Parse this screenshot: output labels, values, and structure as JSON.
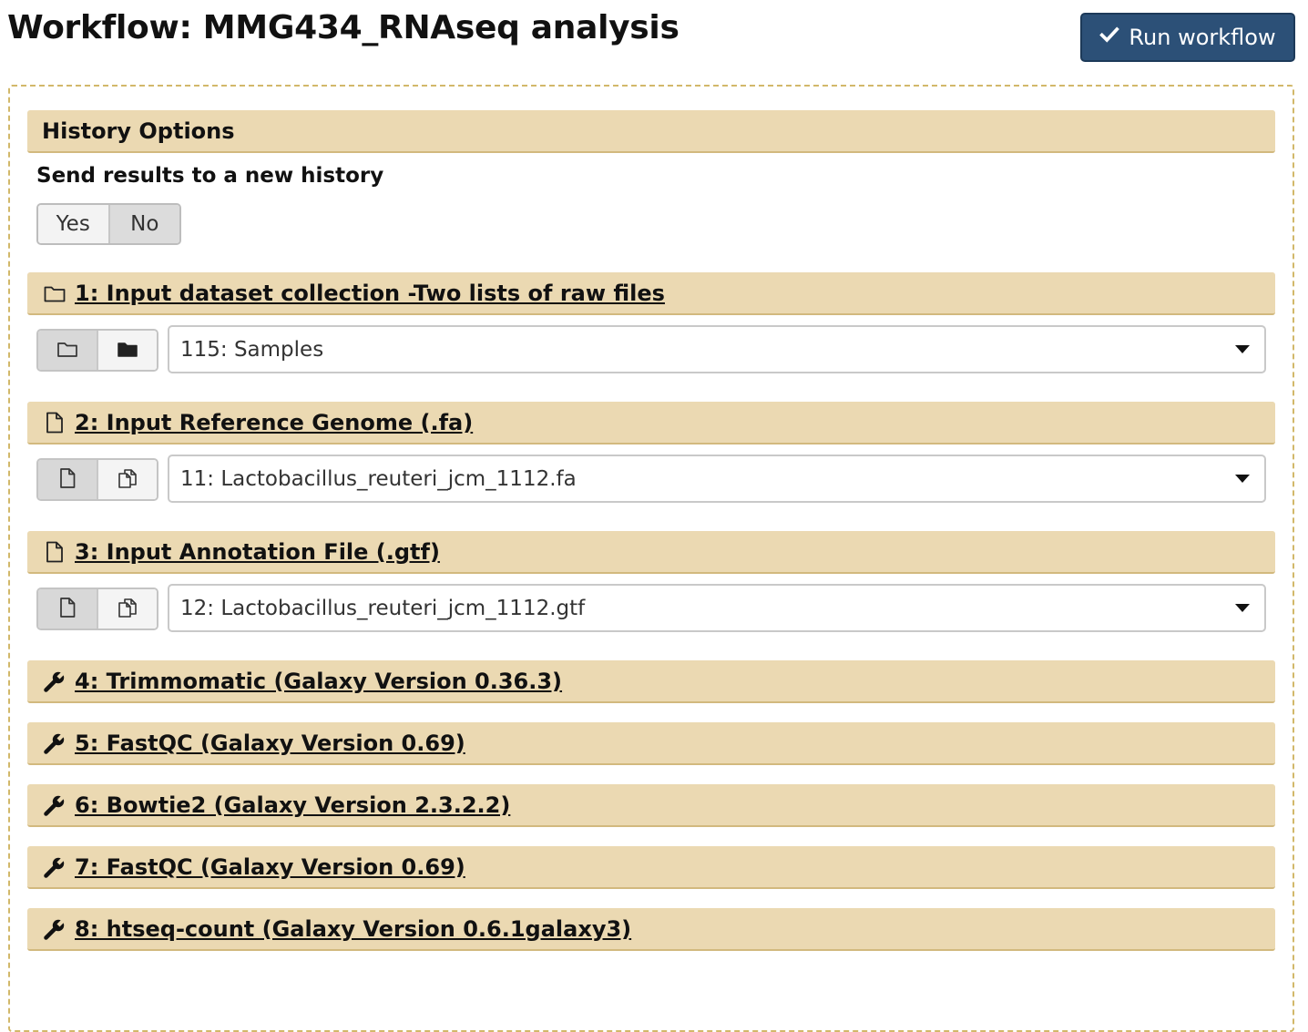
{
  "header": {
    "title": "Workflow: MMG434_RNAseq analysis",
    "run_button_label": "Run workflow"
  },
  "history_options": {
    "heading": "History Options",
    "send_label": "Send results to a new history",
    "toggle": {
      "yes_label": "Yes",
      "no_label": "No",
      "selected": "No"
    }
  },
  "inputs": [
    {
      "title": "1: Input dataset collection -Two lists of raw files",
      "icon": "folder-icon",
      "selected_value": "115: Samples"
    },
    {
      "title": "2: Input Reference Genome (.fa)",
      "icon": "file-icon",
      "selected_value": "11: Lactobacillus_reuteri_jcm_1112.fa"
    },
    {
      "title": "3: Input Annotation File (.gtf)",
      "icon": "file-icon",
      "selected_value": "12: Lactobacillus_reuteri_jcm_1112.gtf"
    }
  ],
  "steps": [
    {
      "title": "4: Trimmomatic (Galaxy Version 0.36.3)",
      "icon": "wrench-icon"
    },
    {
      "title": "5: FastQC (Galaxy Version 0.69)",
      "icon": "wrench-icon"
    },
    {
      "title": "6: Bowtie2 (Galaxy Version 2.3.2.2)",
      "icon": "wrench-icon"
    },
    {
      "title": "7: FastQC (Galaxy Version 0.69)",
      "icon": "wrench-icon"
    },
    {
      "title": "8: htseq-count (Galaxy Version 0.6.1galaxy3)",
      "icon": "wrench-icon"
    }
  ],
  "colors": {
    "run_button_bg": "#2c5077",
    "section_bar_bg": "#ebd9b2",
    "panel_border": "#d2b86a"
  }
}
